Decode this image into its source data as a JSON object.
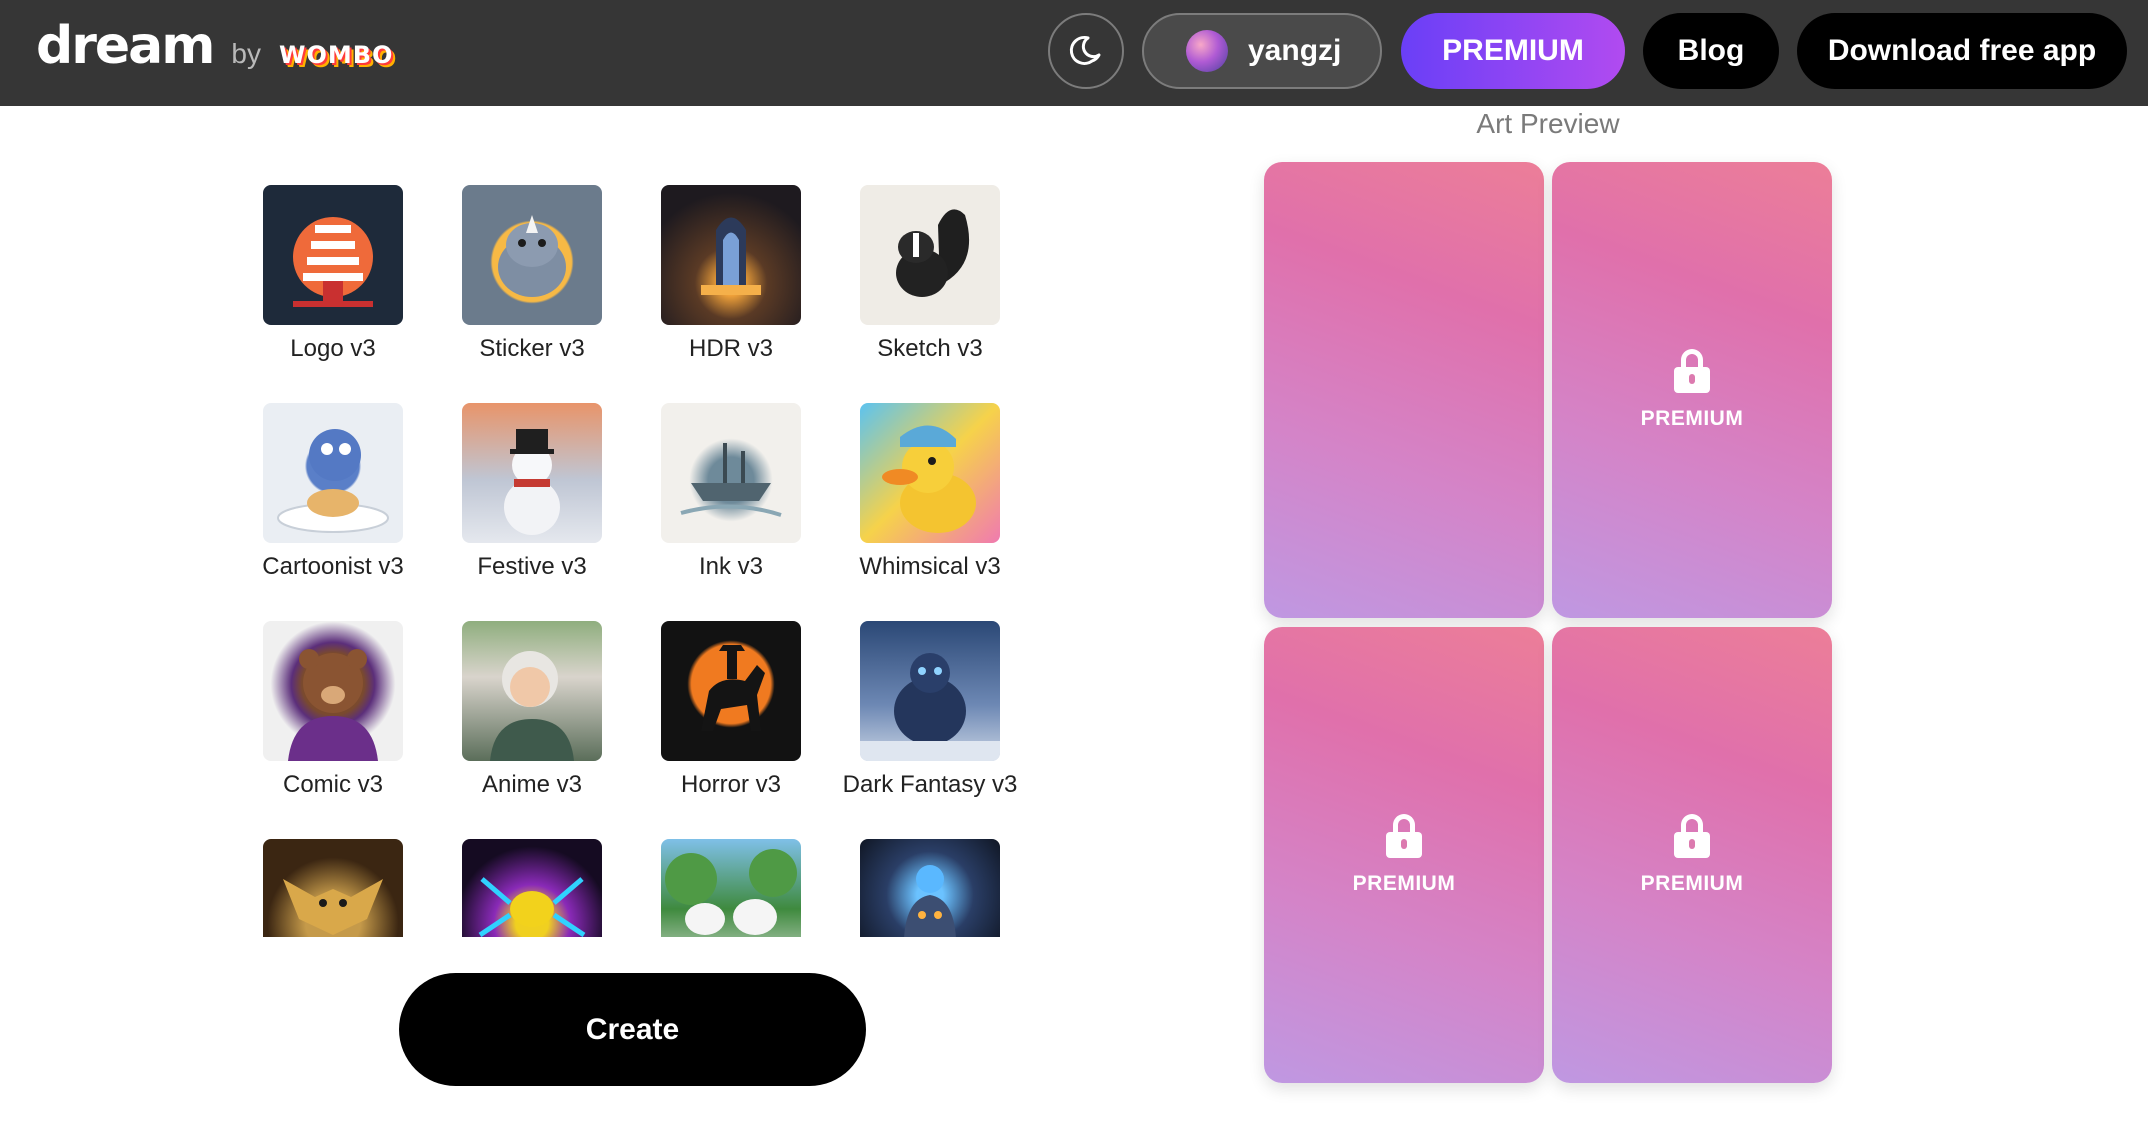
{
  "header": {
    "logo_text": "dream",
    "logo_by": "by",
    "logo_brand": "WOMBO",
    "username": "yangzj",
    "premium_label": "PREMIUM",
    "blog_label": "Blog",
    "download_label": "Download free app"
  },
  "styles": [
    {
      "label": "Logo v3",
      "icon": "pagoda-thumbnail"
    },
    {
      "label": "Sticker v3",
      "icon": "rhino-sticker-thumbnail"
    },
    {
      "label": "HDR v3",
      "icon": "cathedral-thumbnail"
    },
    {
      "label": "Sketch v3",
      "icon": "skunk-sketch-thumbnail"
    },
    {
      "label": "Cartoonist v3",
      "icon": "cartoon-creature-thumbnail"
    },
    {
      "label": "Festive v3",
      "icon": "snowman-thumbnail"
    },
    {
      "label": "Ink v3",
      "icon": "ship-ink-thumbnail"
    },
    {
      "label": "Whimsical v3",
      "icon": "duck-thumbnail"
    },
    {
      "label": "Comic v3",
      "icon": "bear-comic-thumbnail"
    },
    {
      "label": "Anime v3",
      "icon": "grandmother-anime-thumbnail"
    },
    {
      "label": "Horror v3",
      "icon": "horseman-thumbnail"
    },
    {
      "label": "Dark Fantasy v3",
      "icon": "monster-thumbnail"
    },
    {
      "label": "",
      "icon": "bat-creature-thumbnail"
    },
    {
      "label": "",
      "icon": "neon-insect-thumbnail"
    },
    {
      "label": "",
      "icon": "white-cats-thumbnail"
    },
    {
      "label": "",
      "icon": "armored-knight-thumbnail"
    }
  ],
  "create_label": "Create",
  "preview": {
    "title": "Art Preview",
    "cards": [
      {
        "locked": false,
        "label": ""
      },
      {
        "locked": true,
        "label": "PREMIUM"
      },
      {
        "locked": true,
        "label": "PREMIUM"
      },
      {
        "locked": true,
        "label": "PREMIUM"
      }
    ]
  },
  "colors": {
    "header_bg": "#363636",
    "premium_gradient_start": "#6a3ff7",
    "premium_gradient_end": "#b14bf0",
    "card_gradient_top": "#ec7e98",
    "card_gradient_bottom": "#bf98e2"
  }
}
